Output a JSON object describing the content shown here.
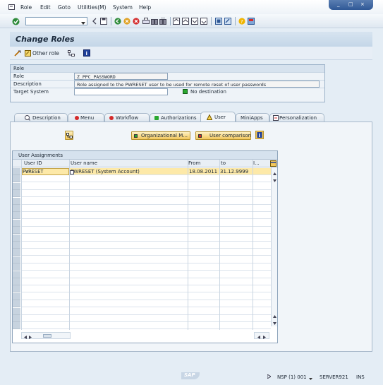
{
  "menu": {
    "items": [
      "Role",
      "Edit",
      "Goto",
      "Utilities(M)",
      "System",
      "Help"
    ]
  },
  "window_controls": [
    "_",
    "□",
    "×"
  ],
  "toolbar": {
    "command_field": {
      "value": "",
      "placeholder": ""
    }
  },
  "title": "Change Roles",
  "app_toolbar": {
    "other_role_label": "Other role"
  },
  "role_panel": {
    "header": "Role",
    "fields": [
      {
        "label": "Role",
        "value": "Z_PPC_PASSWORD"
      },
      {
        "label": "Description",
        "value": "Role assigned to the PWRESET user to be used for remote reset of user passwords"
      },
      {
        "label": "Target System",
        "value": ""
      }
    ],
    "destination_status": "No destination"
  },
  "tabs": [
    {
      "label": "Description",
      "status": "none"
    },
    {
      "label": "Menu",
      "status": "red"
    },
    {
      "label": "Workflow",
      "status": "red"
    },
    {
      "label": "Authorizations",
      "status": "green"
    },
    {
      "label": "User",
      "status": "warning",
      "active": true
    },
    {
      "label": "MiniApps",
      "status": "none"
    },
    {
      "label": "Personalization",
      "status": "none"
    }
  ],
  "buttons": {
    "org_mgmt": "Organizational M...",
    "user_comparison": "User comparison"
  },
  "table": {
    "title": "User Assignments",
    "columns": [
      "User ID",
      "User name",
      "From",
      "to",
      "I..."
    ],
    "rows": [
      {
        "user_id": "PWRESET",
        "user_name": "PWRESET (System Account)",
        "from": "18.08.2011",
        "to": "31.12.9999"
      }
    ]
  },
  "status_bar": {
    "logo": "SAP",
    "system": "NSP (1) 001",
    "server": "SERVER921",
    "mode": "INS"
  },
  "colors": {
    "accent": "#2f5896",
    "button_yellow": "#f2c75c",
    "selected_row": "#fde9a8",
    "status_red": "#d42a2a",
    "status_green": "#2aa830"
  }
}
